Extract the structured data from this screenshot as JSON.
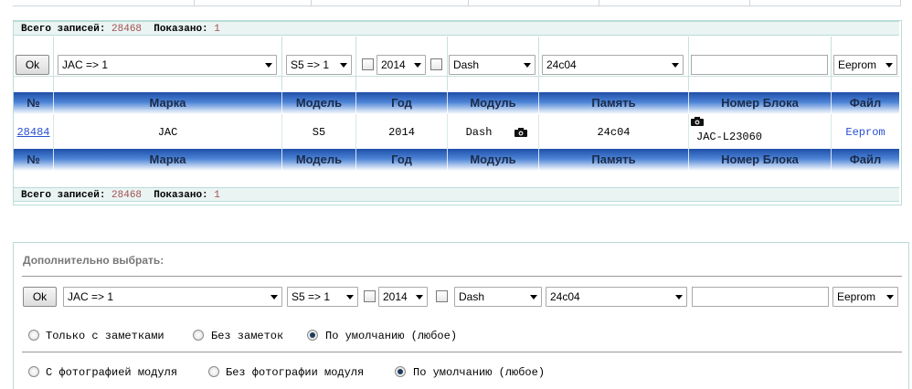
{
  "status": {
    "total_label": "Всего записей:",
    "total_value": "28468",
    "shown_label": "Показано:",
    "shown_value": "1"
  },
  "filters": {
    "ok_label": "Ok",
    "brand": "JAC  => 1",
    "model": "S5 => 1",
    "year": "2014",
    "module": "Dash",
    "memory": "24c04",
    "block_number": "",
    "file_type": "Eeprom"
  },
  "table": {
    "headers": [
      "№",
      "Марка",
      "Модель",
      "Год",
      "Модуль",
      "Память",
      "Номер Блока",
      "Файл"
    ],
    "rows": [
      {
        "id": "28484",
        "brand": "JAC",
        "model": "S5",
        "year": "2014",
        "module": "Dash",
        "memory": "24c04",
        "block": "JAC-L23060",
        "file": "Eeprom"
      }
    ]
  },
  "extra": {
    "title": "Дополнительно выбрать:",
    "notes_options": [
      "Только с заметками",
      "Без заметок",
      "По умолчанию (любое)"
    ],
    "notes_selected": 2,
    "photo_options": [
      "С фотографией модуля",
      "Без фотографии модуля",
      "По умолчанию (любое)"
    ],
    "photo_selected": 2
  },
  "icons": {
    "select_arrow": "chevron-down-icon",
    "camera": "camera-icon"
  },
  "colors": {
    "header_dark": "#1f4fa8",
    "header_mid": "#4b83d6",
    "panel_border": "#b9dcd8",
    "status_bg": "#eaf4f3",
    "link": "#2a4fd0"
  }
}
